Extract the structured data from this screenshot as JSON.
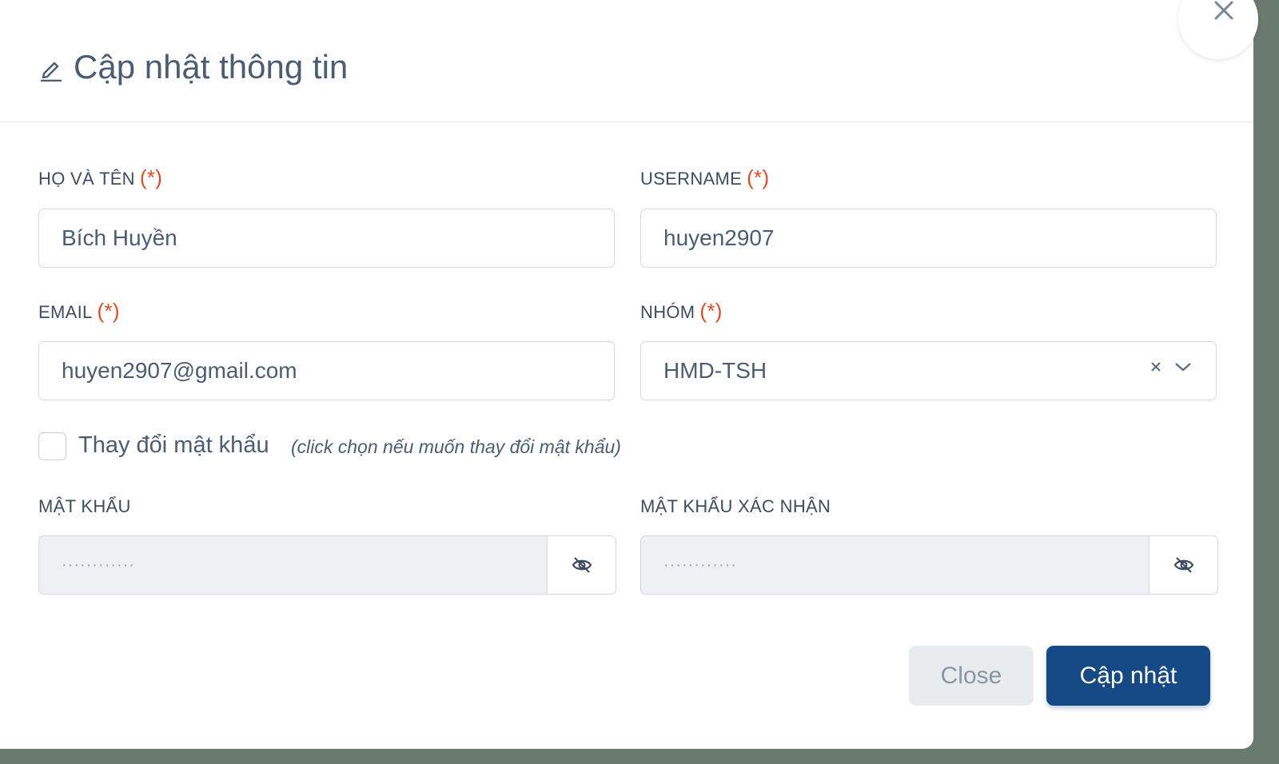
{
  "modal": {
    "title": "Cập nhật thông tin",
    "required_mark": "(*)"
  },
  "fields": {
    "full_name": {
      "label": "HỌ VÀ TÊN",
      "value": "Bích Huyền"
    },
    "username": {
      "label": "USERNAME",
      "value": "huyen2907"
    },
    "email": {
      "label": "EMAIL",
      "value": "huyen2907@gmail.com"
    },
    "group": {
      "label": "NHÓM",
      "value": "HMD-TSH"
    },
    "password": {
      "label": "MẬT KHẨU",
      "placeholder": "············"
    },
    "confirm_password": {
      "label": "MẬT KHẨU XÁC NHẬN",
      "placeholder": "············"
    }
  },
  "change_password": {
    "label": "Thay đổi mật khẩu",
    "hint": "(click chọn nếu muốn thay đổi mật khẩu)",
    "checked": false
  },
  "buttons": {
    "close": "Close",
    "update": "Cập nhật"
  },
  "icons": {
    "title": "pencil-icon",
    "close": "close-icon",
    "clear": "clear-icon",
    "dropdown": "chevron-down-icon",
    "eye": "eye-off-icon"
  },
  "colors": {
    "primary": "#164a87",
    "required": "#e8491f",
    "text": "#4a5d73"
  }
}
